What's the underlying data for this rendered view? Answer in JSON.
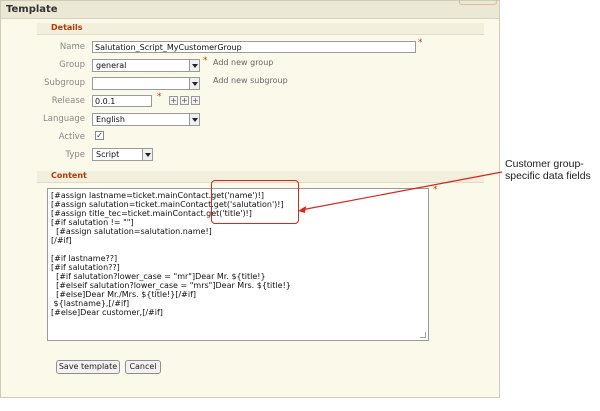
{
  "panel": {
    "title": "Template"
  },
  "details": {
    "heading": "Details",
    "name": {
      "label": "Name",
      "value": "Salutation_Script_MyCustomerGroup",
      "required": "*"
    },
    "group": {
      "label": "Group",
      "value": "general",
      "required": "*",
      "link": "Add new group"
    },
    "subgroup": {
      "label": "Subgroup",
      "value": "",
      "link": "Add new subgroup"
    },
    "release": {
      "label": "Release",
      "value": "0.0.1",
      "required": "*",
      "buttons": [
        "+",
        "+",
        "+"
      ]
    },
    "language": {
      "label": "Language",
      "value": "English"
    },
    "active": {
      "label": "Active",
      "checked": "✓"
    },
    "type": {
      "label": "Type",
      "value": "Script"
    }
  },
  "content": {
    "heading": "Content",
    "required": "*",
    "lines": [
      "[#assign lastname=ticket.mainContact.get('name')!]",
      "[#assign salutation=ticket.mainContact.get('salutation')!]",
      "[#assign title_tec=ticket.mainContact.get('title')!]",
      "[#if salutation != \"\"]",
      "  [#assign salutation=salutation.name!]",
      "[/#if]",
      "",
      "[#if lastname??]",
      "[#if salutation??]",
      "  [#if salutation?lower_case = \"mr\"]Dear Mr. ${title!}",
      "  [#elseif salutation?lower_case = \"mrs\"]Dear Mrs. ${title!}",
      "  [#else]Dear Mr./Mrs. ${title!}[/#if]",
      " ${lastname},[/#if]",
      "[#else]Dear customer,[/#if]"
    ]
  },
  "actions": {
    "save": "Save template",
    "cancel": "Cancel"
  },
  "annotation": {
    "text": "Customer group-specific data fields"
  },
  "colors": {
    "accent": "#b13b0e",
    "callout": "#d8271b",
    "panel_bg": "#fbf9ea"
  }
}
